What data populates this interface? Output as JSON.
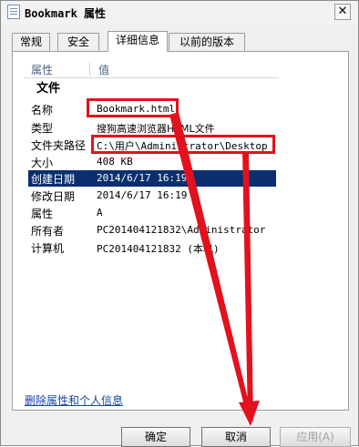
{
  "window": {
    "title": "Bookmark 属性",
    "close_glyph": "✕"
  },
  "tabs": [
    {
      "label": "常规"
    },
    {
      "label": "安全"
    },
    {
      "label": "详细信息"
    },
    {
      "label": "以前的版本"
    }
  ],
  "details": {
    "col_property": "属性",
    "col_value": "值",
    "group_label": "文件",
    "rows": [
      {
        "name": "名称",
        "value": "Bookmark.html"
      },
      {
        "name": "类型",
        "value": "搜狗高速浏览器HTML文件"
      },
      {
        "name": "文件夹路径",
        "value": "C:\\用户\\Administrator\\Desktop"
      },
      {
        "name": "大小",
        "value": "408 KB"
      },
      {
        "name": "创建日期",
        "value": "2014/6/17 16:19"
      },
      {
        "name": "修改日期",
        "value": "2014/6/17 16:19"
      },
      {
        "name": "属性",
        "value": "A"
      },
      {
        "name": "所有者",
        "value": "PC201404121832\\Administrator"
      },
      {
        "name": "计算机",
        "value": "PC201404121832 (本机)"
      }
    ]
  },
  "remove_link": "删除属性和个人信息",
  "buttons": {
    "ok": "确定",
    "cancel": "取消",
    "apply": "应用(A)"
  },
  "colors": {
    "selection": "#0b2f6d",
    "annotation": "#e1121d",
    "link": "#1645a3"
  }
}
